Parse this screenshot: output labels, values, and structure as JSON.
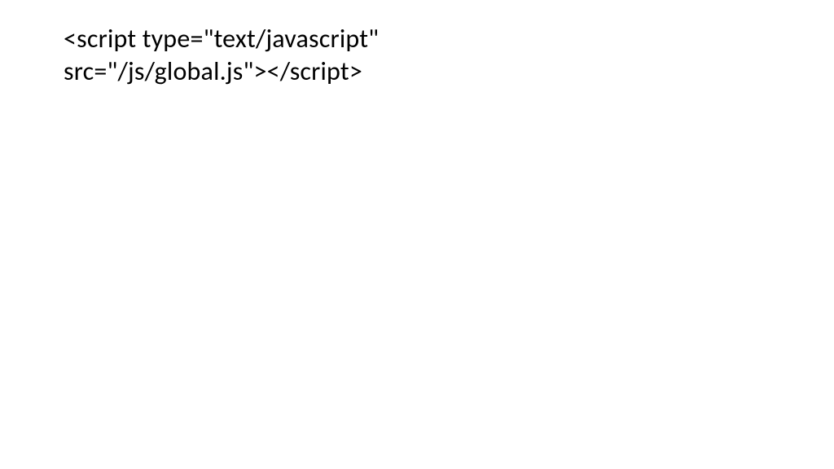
{
  "content": {
    "line1": "<script type=\"text/javascript\"",
    "line2": "src=\"/js/global.js\"></script>"
  }
}
